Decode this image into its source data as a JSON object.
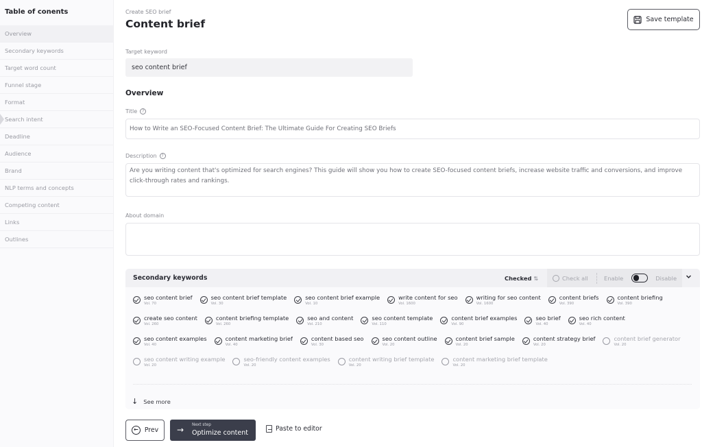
{
  "sidebar": {
    "title": "Table of conents",
    "items": [
      {
        "label": "Overview",
        "active": true
      },
      {
        "label": "Secondary keywords"
      },
      {
        "label": "Target word count"
      },
      {
        "label": "Funnel stage"
      },
      {
        "label": "Format"
      },
      {
        "label": "Search intent"
      },
      {
        "label": "Deadline"
      },
      {
        "label": "Audience"
      },
      {
        "label": "Brand"
      },
      {
        "label": "NLP terms and concepts"
      },
      {
        "label": "Competing content"
      },
      {
        "label": "Links"
      },
      {
        "label": "Outlines"
      }
    ]
  },
  "header": {
    "breadcrumb": "Create SEO brief",
    "title": "Content brief",
    "save_template_label": "Save template",
    "save_icon": "floppy-disk-icon"
  },
  "target_keyword": {
    "label": "Target keyword",
    "value": "seo content brief"
  },
  "overview": {
    "heading": "Overview",
    "title_label": "Title",
    "title_value": "How to Write an SEO-Focused Content Brief: The Ultimate Guide For Creating SEO Briefs",
    "description_label": "Description",
    "description_value": "Are you writing content that's optimized for search engines? This guide will show you how to create SEO-focused content briefs, increase website traffic and conversions, and improve click-through rates and rankings.",
    "about_domain_label": "About domain",
    "about_domain_value": "",
    "help_glyph": "?"
  },
  "secondary_keywords": {
    "title": "Secondary keywords",
    "sort_label": "Checked",
    "sort_glyph": "⇅",
    "check_all_label": "Check all",
    "enable_label": "Enable",
    "disable_label": "Disable",
    "toggle_state": "enabled",
    "chevron_glyph": "⌄",
    "see_more_label": "See more",
    "see_more_glyph": "↓",
    "rows": [
      [
        {
          "name": "seo content brief",
          "vol": "Vol. 70",
          "checked": true
        },
        {
          "name": "seo content brief template",
          "vol": "Vol. 30",
          "checked": true
        },
        {
          "name": "seo content brief example",
          "vol": "Vol. 10",
          "checked": true
        },
        {
          "name": "write content for seo",
          "vol": "Vol. 1600",
          "checked": true
        },
        {
          "name": "writing for seo content",
          "vol": "Vol. 1600",
          "checked": true
        },
        {
          "name": "content briefs",
          "vol": "Vol. 390",
          "checked": true
        },
        {
          "name": "content briefing",
          "vol": "Vol. 390",
          "checked": true
        }
      ],
      [
        {
          "name": "create seo content",
          "vol": "Vol. 260",
          "checked": true
        },
        {
          "name": "content briefing template",
          "vol": "Vol. 260",
          "checked": true
        },
        {
          "name": "seo and content",
          "vol": "Vol. 210",
          "checked": true
        },
        {
          "name": "seo content template",
          "vol": "Vol. 110",
          "checked": true
        },
        {
          "name": "content brief examples",
          "vol": "Vol. 90",
          "checked": true
        },
        {
          "name": "seo brief",
          "vol": "Vol. 40",
          "checked": true
        },
        {
          "name": "seo rich content",
          "vol": "Vol. 40",
          "checked": true
        }
      ],
      [
        {
          "name": "seo content examples",
          "vol": "Vol. 40",
          "checked": true
        },
        {
          "name": "content marketing brief",
          "vol": "Vol. 40",
          "checked": true
        },
        {
          "name": "content based seo",
          "vol": "Vol. 30",
          "checked": true
        },
        {
          "name": "seo content outline",
          "vol": "Vol. 20",
          "checked": true
        },
        {
          "name": "content brief sample",
          "vol": "Vol. 20",
          "checked": true
        },
        {
          "name": "content strategy brief",
          "vol": "Vol. 20",
          "checked": true
        },
        {
          "name": "content brief generator",
          "vol": "Vol. 20",
          "checked": false
        }
      ],
      [
        {
          "name": "seo content writing example",
          "vol": "Vol. 20",
          "checked": false
        },
        {
          "name": "seo-friendly content examples",
          "vol": "Vol. 20",
          "checked": false
        },
        {
          "name": "content writing brief template",
          "vol": "Vol. 20",
          "checked": false
        },
        {
          "name": "content marketing brief template",
          "vol": "Vol. 20",
          "checked": false
        }
      ]
    ]
  },
  "footer": {
    "prev_label": "Prev",
    "prev_glyph": "←",
    "next_small": "Next step",
    "next_label": "Optimize content",
    "next_glyph": "→",
    "paste_label": "Paste to editor"
  }
}
